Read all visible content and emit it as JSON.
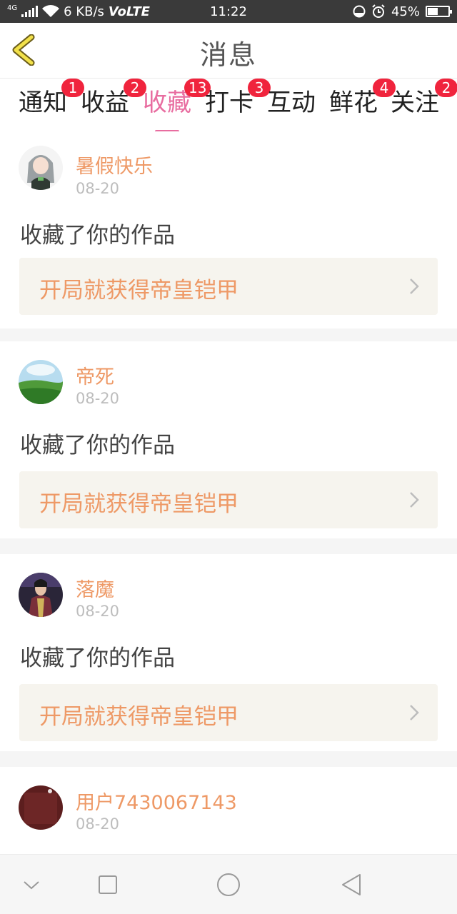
{
  "status_bar": {
    "network_type": "4G",
    "speed": "6 KB/s",
    "volte": "VoLTE",
    "time": "11:22",
    "battery_percent": "45%",
    "battery_level": 0.45
  },
  "header": {
    "title": "消息",
    "back_icon": "chevron-left-icon",
    "accent_color": "#e8d23a"
  },
  "tabs": [
    {
      "label": "通知",
      "badge": "1",
      "active": false
    },
    {
      "label": "收益",
      "badge": "2",
      "active": false
    },
    {
      "label": "收藏",
      "badge": "13",
      "active": true
    },
    {
      "label": "打卡",
      "badge": "3",
      "active": false
    },
    {
      "label": "互动",
      "badge": "",
      "active": false
    },
    {
      "label": "鲜花",
      "badge": "4",
      "active": false
    },
    {
      "label": "关注",
      "badge": "2",
      "active": false
    }
  ],
  "colors": {
    "active_tab": "#e86da0",
    "badge": "#f0243d",
    "username": "#ee9966",
    "link_bg": "#f6f4ee"
  },
  "messages": [
    {
      "user": "暑假快乐",
      "date": "08-20",
      "action": "收藏了你的作品",
      "work": "开局就获得帝皇铠甲",
      "avatar": "anime-girl-avatar"
    },
    {
      "user": "帝死",
      "date": "08-20",
      "action": "收藏了你的作品",
      "work": "开局就获得帝皇铠甲",
      "avatar": "green-field-avatar"
    },
    {
      "user": "落魔",
      "date": "08-20",
      "action": "收藏了你的作品",
      "work": "开局就获得帝皇铠甲",
      "avatar": "costume-figure-avatar"
    },
    {
      "user": "用户7430067143",
      "date": "08-20",
      "action": "",
      "work": "",
      "avatar": "dark-red-avatar"
    }
  ],
  "nav_bar": {
    "buttons": [
      "chevron-down-icon",
      "square-icon",
      "circle-icon",
      "triangle-back-icon"
    ]
  }
}
